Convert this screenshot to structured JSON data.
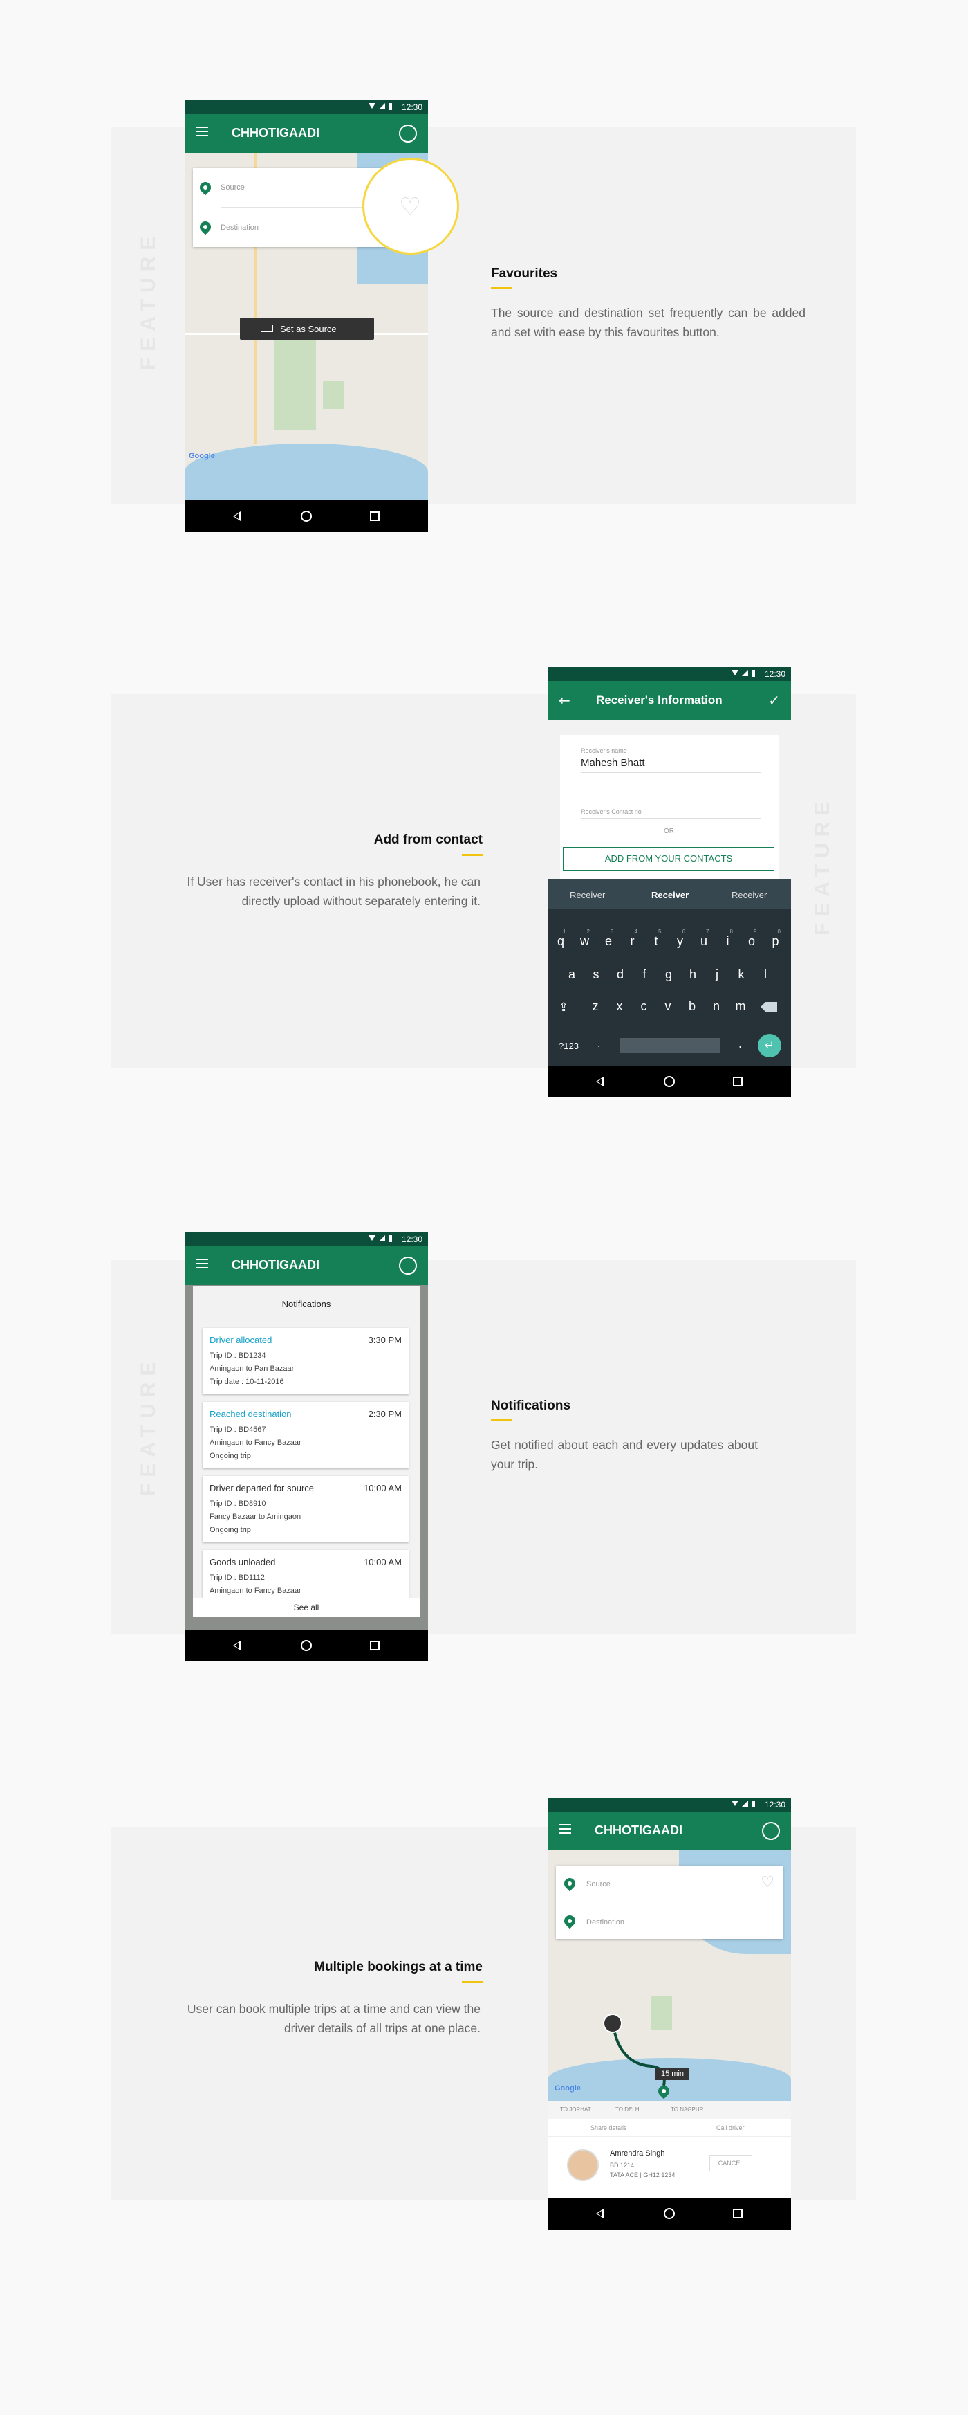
{
  "feature_label": "FEATURE",
  "status_time": "12:30",
  "app_title": "CHHOTIGAADI",
  "section1": {
    "heading": "Favourites",
    "description": "The source and destination set frequently can be added and set with ease by this favourites button.",
    "source_placeholder": "Source",
    "destination_placeholder": "Destination",
    "set_source_label": "Set as Source",
    "google_label": "Google"
  },
  "section2": {
    "heading": "Add from contact",
    "description": "If User has receiver's contact in his phonebook, he can directly upload without separately entering it.",
    "screen_title": "Receiver's Information",
    "name_label": "Receiver's name",
    "name_value": "Mahesh Bhatt",
    "contact_label": "Receiver's Contact no",
    "or_label": "OR",
    "contacts_button": "ADD FROM YOUR CONTACTS",
    "suggestions": [
      "Receiver",
      "Receiver",
      "Receiver"
    ],
    "keyboard": {
      "row1": [
        "q",
        "w",
        "e",
        "r",
        "t",
        "y",
        "u",
        "i",
        "o",
        "p"
      ],
      "row1_numbers": [
        "1",
        "2",
        "3",
        "4",
        "5",
        "6",
        "7",
        "8",
        "9",
        "0"
      ],
      "row2": [
        "a",
        "s",
        "d",
        "f",
        "g",
        "h",
        "j",
        "k",
        "l"
      ],
      "row3": [
        "z",
        "x",
        "c",
        "v",
        "b",
        "n",
        "m"
      ],
      "symbols_key": "?123",
      "comma_key": ",",
      "period_key": "."
    }
  },
  "section3": {
    "heading": "Notifications",
    "description": "Get notified about each and every updates about your trip.",
    "panel_title": "Notifications",
    "see_all": "See all",
    "items": [
      {
        "title": "Driver allocated",
        "time": "3:30 PM",
        "highlight": true,
        "lines": [
          "Trip ID : BD1234",
          "Amingaon to Pan Bazaar",
          "Trip date : 10-11-2016"
        ]
      },
      {
        "title": "Reached destination",
        "time": "2:30 PM",
        "highlight": true,
        "lines": [
          "Trip ID : BD4567",
          "Amingaon to Fancy Bazaar",
          "Ongoing trip"
        ]
      },
      {
        "title": "Driver departed for source",
        "time": "10:00 AM",
        "highlight": false,
        "lines": [
          "Trip ID : BD8910",
          "Fancy Bazaar to Amingaon",
          "Ongoing trip"
        ]
      },
      {
        "title": "Goods unloaded",
        "time": "10:00 AM",
        "highlight": false,
        "lines": [
          "Trip ID : BD1112",
          "Amingaon to Fancy Bazaar"
        ]
      }
    ]
  },
  "section4": {
    "heading": "Multiple bookings at a time",
    "description": "User can book multiple trips at a time and can view the driver details of all trips at one place.",
    "source_placeholder": "Source",
    "destination_placeholder": "Destination",
    "eta_label": "15 min",
    "google_label": "Google",
    "trip_tabs": [
      "TO JORHAT",
      "TO DELHI",
      "TO NAGPUR"
    ],
    "share_details": "Share details",
    "call_driver": "Call driver",
    "driver_name": "Amrendra Singh",
    "driver_id": "BD 1214",
    "vehicle": "TATA ACE | GH12 1234",
    "cancel_label": "CANCEL"
  },
  "colors": {
    "primary_green": "#157f55",
    "status_green": "#0b4f3b",
    "accent_yellow": "#f1c40f",
    "notification_blue": "#1aa3c9"
  }
}
